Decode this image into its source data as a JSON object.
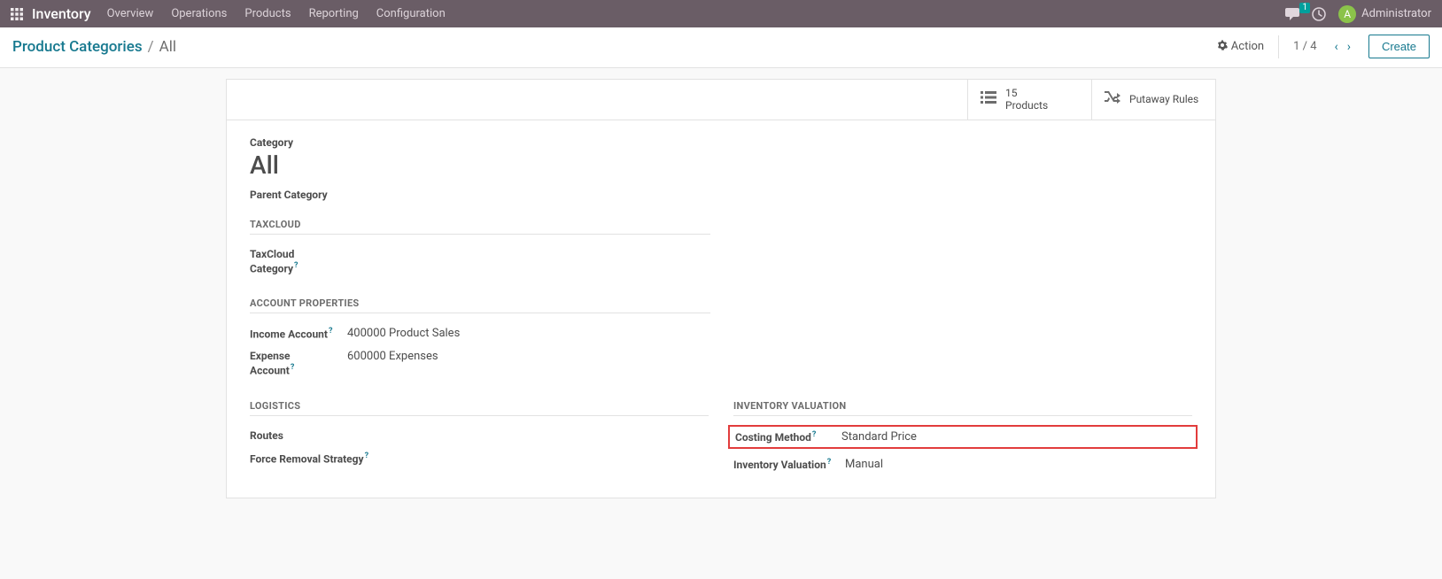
{
  "topnav": {
    "app_name": "Inventory",
    "links": [
      "Overview",
      "Operations",
      "Products",
      "Reporting",
      "Configuration"
    ],
    "discuss_badge": "1",
    "user_initial": "A",
    "user_name": "Administrator"
  },
  "control_panel": {
    "breadcrumb_root": "Product Categories",
    "breadcrumb_current": "All",
    "action_label": "Action",
    "pager": "1 / 4",
    "create_label": "Create"
  },
  "stat_buttons": {
    "products_count": "15",
    "products_label": "Products",
    "putaway_label": "Putaway Rules"
  },
  "form": {
    "category_label": "Category",
    "category_value": "All",
    "parent_category_label": "Parent Category",
    "taxcloud_section": "TAXCLOUD",
    "taxcloud_category_label": "TaxCloud Category",
    "account_props_section": "ACCOUNT PROPERTIES",
    "income_account_label": "Income Account",
    "income_account_value": "400000 Product Sales",
    "expense_account_label": "Expense Account",
    "expense_account_value": "600000 Expenses",
    "logistics_section": "LOGISTICS",
    "routes_label": "Routes",
    "force_removal_label": "Force Removal Strategy",
    "inventory_valuation_section": "INVENTORY VALUATION",
    "costing_method_label": "Costing Method",
    "costing_method_value": "Standard Price",
    "inventory_valuation_label": "Inventory Valuation",
    "inventory_valuation_value": "Manual"
  }
}
